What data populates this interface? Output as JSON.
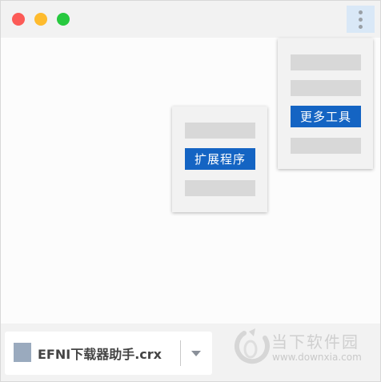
{
  "window": {
    "controls": [
      "close",
      "minimize",
      "zoom"
    ],
    "menu_icon": "more-vert-icon"
  },
  "main_menu": {
    "highlighted_item": "更多工具",
    "placeholder_rows": 3
  },
  "submenu": {
    "highlighted_item": "扩展程序",
    "placeholder_rows": 2
  },
  "download": {
    "file_name": "EFNI下载器助手.crx",
    "file_icon": "file-icon",
    "dropdown_icon": "caret-down-icon"
  },
  "watermark": {
    "name": "当下软件园",
    "url": "www.downxia.com"
  },
  "colors": {
    "highlight": "#1464c3",
    "menu_button_bg": "#d9e8f7",
    "close": "#fc5b57",
    "minimize": "#febb2e",
    "zoom": "#27c93f"
  }
}
